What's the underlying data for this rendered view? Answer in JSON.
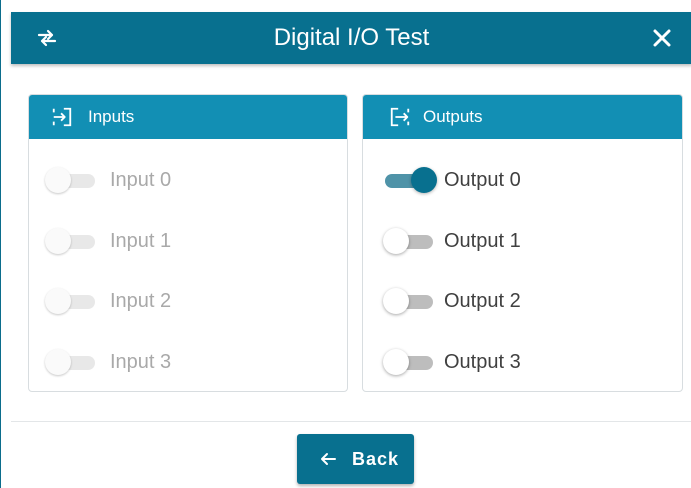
{
  "dialog": {
    "title": "Digital I/O Test",
    "left_icon": "swap-arrows-icon",
    "close_icon": "close-icon"
  },
  "inputs": {
    "header": "Inputs",
    "header_icon": "input-icon",
    "items": [
      {
        "label": "Input 0",
        "state": "off",
        "enabled": false
      },
      {
        "label": "Input 1",
        "state": "off",
        "enabled": false
      },
      {
        "label": "Input 2",
        "state": "off",
        "enabled": false
      },
      {
        "label": "Input 3",
        "state": "off",
        "enabled": false
      }
    ]
  },
  "outputs": {
    "header": "Outputs",
    "header_icon": "output-icon",
    "items": [
      {
        "label": "Output 0",
        "state": "on",
        "enabled": true
      },
      {
        "label": "Output 1",
        "state": "off",
        "enabled": true
      },
      {
        "label": "Output 2",
        "state": "off",
        "enabled": true
      },
      {
        "label": "Output 3",
        "state": "off",
        "enabled": true
      }
    ]
  },
  "footer": {
    "back_label": "Back",
    "back_icon": "arrow-left-icon"
  },
  "colors": {
    "title_bar": "#08708f",
    "panel_header": "#128fb4",
    "toggle_on": "#08708f"
  }
}
